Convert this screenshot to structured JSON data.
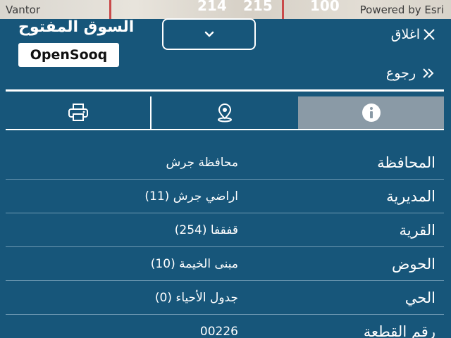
{
  "map": {
    "credit_left": "Vantor",
    "credit_right": "Powered by Esri",
    "parcel_labels": [
      "214",
      "215",
      "100"
    ]
  },
  "watermark": {
    "arabic_name": "السوق المفتوح",
    "brand": "OpenSooq"
  },
  "panel": {
    "close_label": "اغلاق",
    "back_label": "رجوع",
    "tabs": [
      "info-icon",
      "location-pin-icon",
      "printer-icon"
    ],
    "accent_color": "#17567a",
    "active_tab_color": "#8a9aa6"
  },
  "details": [
    {
      "label": "المحافظة",
      "value": "محافظة جرش"
    },
    {
      "label": "المديرية",
      "value": "اراضي جرش (11)"
    },
    {
      "label": "القرية",
      "value": "قفقفا (254)"
    },
    {
      "label": "الحوض",
      "value": "مبنى الخيمة (10)"
    },
    {
      "label": "الحي",
      "value": "جدول الأحياء (0)"
    },
    {
      "label": "رقم القطعة",
      "value": "00226"
    }
  ]
}
